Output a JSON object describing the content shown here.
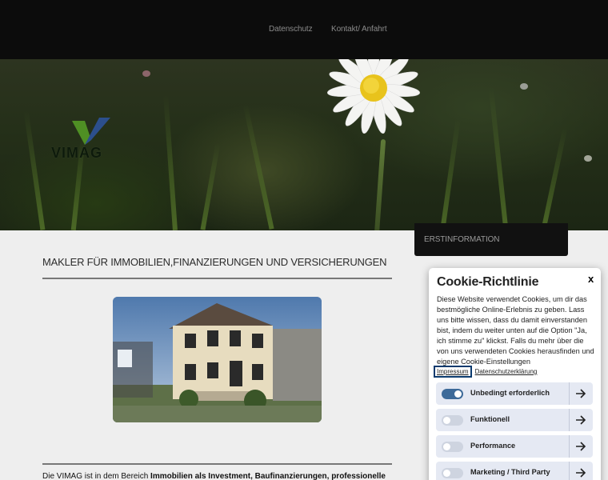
{
  "nav": {
    "items": [
      {
        "label": "Datenschutz"
      },
      {
        "label": "Kontakt/ Anfahrt"
      }
    ]
  },
  "brand": {
    "logo_text": "VIMAG",
    "colors": {
      "green": "#4f8f24",
      "blue": "#2c4f8c"
    }
  },
  "main": {
    "title": "MAKLER FÜR IMMOBILIEN,FINANZIERUNGEN UND VERSICHERUNGEN",
    "intro_plain_1": "Die VIMAG ist in dem Bereich ",
    "intro_bold_1": "Immobilien als Investment, Baufinanzierungen, professionelle"
  },
  "sidebar": {
    "box_label": "ERSTINFORMATION"
  },
  "cookie": {
    "title": "Cookie-Richtlinie",
    "close": "x",
    "body": "Diese Website verwendet Cookies, um dir das bestmögliche Online-Erlebnis zu geben. Lass uns bitte wissen, dass du damit einverstanden bist, indem du weiter unten auf die Option \"Ja, ich stimme zu\" klickst. Falls du mehr über die von uns verwendeten Cookies herausfinden und eigene Cookie-Einstellungen",
    "links": {
      "impressum": "Impressum",
      "datenschutz": "Datenschutzerklärung"
    },
    "options": [
      {
        "label": "Unbedingt erforderlich",
        "enabled": true
      },
      {
        "label": "Funktionell",
        "enabled": false
      },
      {
        "label": "Performance",
        "enabled": false
      },
      {
        "label": "Marketing / Third Party",
        "enabled": false
      }
    ],
    "accent_color": "#3d6a99"
  }
}
